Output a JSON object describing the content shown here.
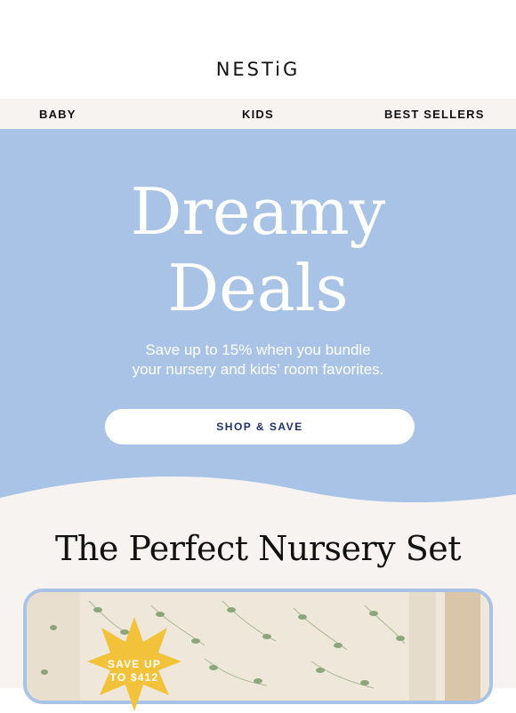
{
  "brand": {
    "logo": "NESTiG"
  },
  "nav": [
    {
      "label": "BABY"
    },
    {
      "label": "KIDS"
    },
    {
      "label": "BEST SELLERS"
    }
  ],
  "hero": {
    "title_line1": "Dreamy",
    "title_line2": "Deals",
    "subtitle_line1": "Save up to 15% when you bundle",
    "subtitle_line2": "your nursery and kids’ room favorites.",
    "cta_label": "SHOP & SAVE",
    "background_color": "#a9c3e6"
  },
  "section": {
    "title": "The Perfect Nursery Set",
    "badge_line1": "SAVE UP",
    "badge_line2": "TO $412",
    "badge_color": "#f2c23a"
  },
  "colors": {
    "accent_text": "#1f2f6b",
    "cream": "#f7f3f0"
  }
}
